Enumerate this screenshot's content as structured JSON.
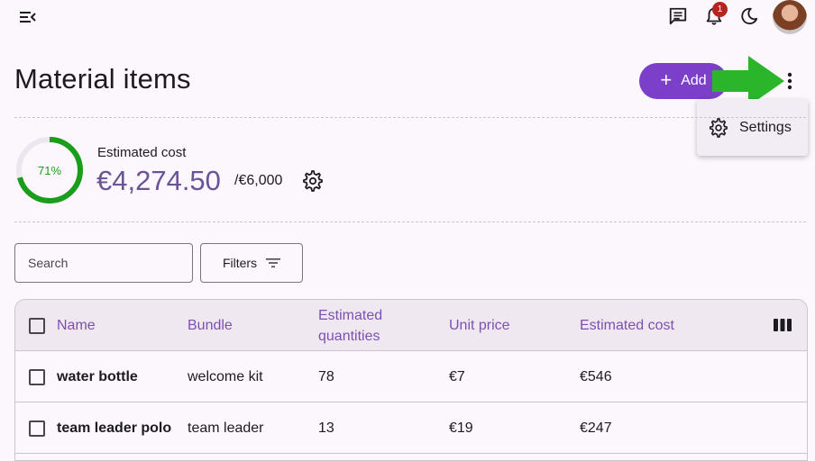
{
  "topbar": {
    "menu_icon": "menu-collapse-icon",
    "chat_icon": "message-icon",
    "notifications_icon": "bell-icon",
    "notifications_count": "1",
    "theme_icon": "moon-icon",
    "avatar": "user-avatar"
  },
  "header": {
    "title": "Material items",
    "add_label": "Add",
    "more_icon": "more-vert-icon"
  },
  "menu": {
    "items": [
      {
        "label": "Settings",
        "icon": "gear-icon"
      }
    ]
  },
  "summary": {
    "progress_percent": 71,
    "progress_label": "71%",
    "label": "Estimated cost",
    "value": "€4,274.50",
    "budget": "/€6,000",
    "progress_color": "#1b9d1b"
  },
  "toolbar": {
    "search_placeholder": "Search",
    "filters_label": "Filters"
  },
  "table": {
    "columns": [
      "Name",
      "Bundle",
      "Estimated quantities",
      "Unit price",
      "Estimated cost"
    ],
    "rows": [
      {
        "name": "water bottle",
        "bundle": "welcome kit",
        "quantity": "78",
        "unit_price": "€7",
        "cost": "€546"
      },
      {
        "name": "team leader polo",
        "bundle": "team leader",
        "quantity": "13",
        "unit_price": "€19",
        "cost": "€247"
      }
    ]
  },
  "colors": {
    "accent": "#7b3fc9",
    "header_text": "#7e4fb3",
    "arrow": "#2bb52b",
    "background": "#fcf7fd"
  }
}
